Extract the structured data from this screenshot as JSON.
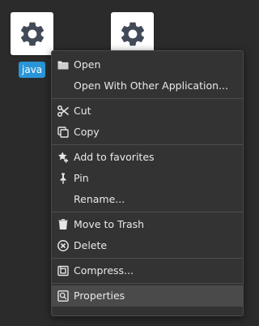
{
  "desktop": {
    "files": [
      {
        "icon": "gear-icon",
        "label": "java",
        "selected": true
      },
      {
        "icon": "gear-icon",
        "label": ""
      }
    ],
    "colors": {
      "background": "#2b2b2b",
      "selection": "#2a95d6",
      "menu_bg": "#333333",
      "menu_hover": "#4a4a4a"
    }
  },
  "context_menu": {
    "items": [
      {
        "label": "Open",
        "icon": "folder-icon"
      },
      {
        "label": "Open With Other Application...",
        "icon": ""
      },
      {
        "label": "Cut",
        "icon": "scissors-icon"
      },
      {
        "label": "Copy",
        "icon": "copy-icon"
      },
      {
        "label": "Add to favorites",
        "icon": "star-plus-icon"
      },
      {
        "label": "Pin",
        "icon": "pin-icon"
      },
      {
        "label": "Rename...",
        "icon": ""
      },
      {
        "label": "Move to Trash",
        "icon": "trash-icon"
      },
      {
        "label": "Delete",
        "icon": "delete-circle-icon"
      },
      {
        "label": "Compress...",
        "icon": "archive-icon"
      },
      {
        "label": "Properties",
        "icon": "properties-icon",
        "hovered": true
      }
    ]
  }
}
